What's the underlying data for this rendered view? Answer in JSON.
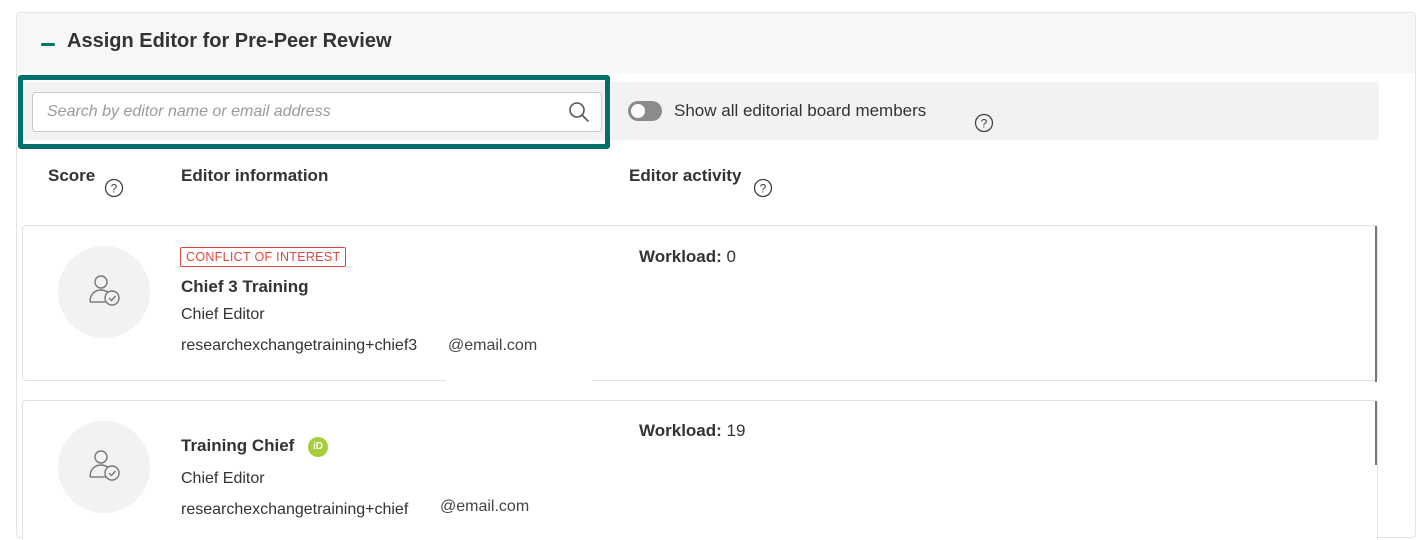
{
  "panel": {
    "title": "Assign Editor for Pre-Peer Review",
    "collapse_icon": "minus-icon"
  },
  "search": {
    "placeholder": "Search by editor name or email address",
    "value": "",
    "icon": "search-icon"
  },
  "toggle": {
    "label": "Show all editorial board members",
    "state": "off"
  },
  "columns": {
    "score": "Score",
    "editor_information": "Editor information",
    "editor_activity": "Editor activity"
  },
  "editors": [
    {
      "badge": "CONFLICT OF INTEREST",
      "name": "Chief 3 Training",
      "role": "Chief Editor",
      "email": "researchexchangetraining+chief3",
      "email_domain": "@email.com",
      "workload_label": "Workload:",
      "workload_value": "0"
    },
    {
      "badge": "",
      "name": "Training Chief",
      "orcid": "iD",
      "role": "Chief Editor",
      "email": "researchexchangetraining+chief",
      "email_domain": "@email.com",
      "workload_label": "Workload:",
      "workload_value": "19"
    }
  ],
  "colors": {
    "accent": "#02706a",
    "conflict": "#e2463f",
    "orcid": "#a6ce39"
  }
}
